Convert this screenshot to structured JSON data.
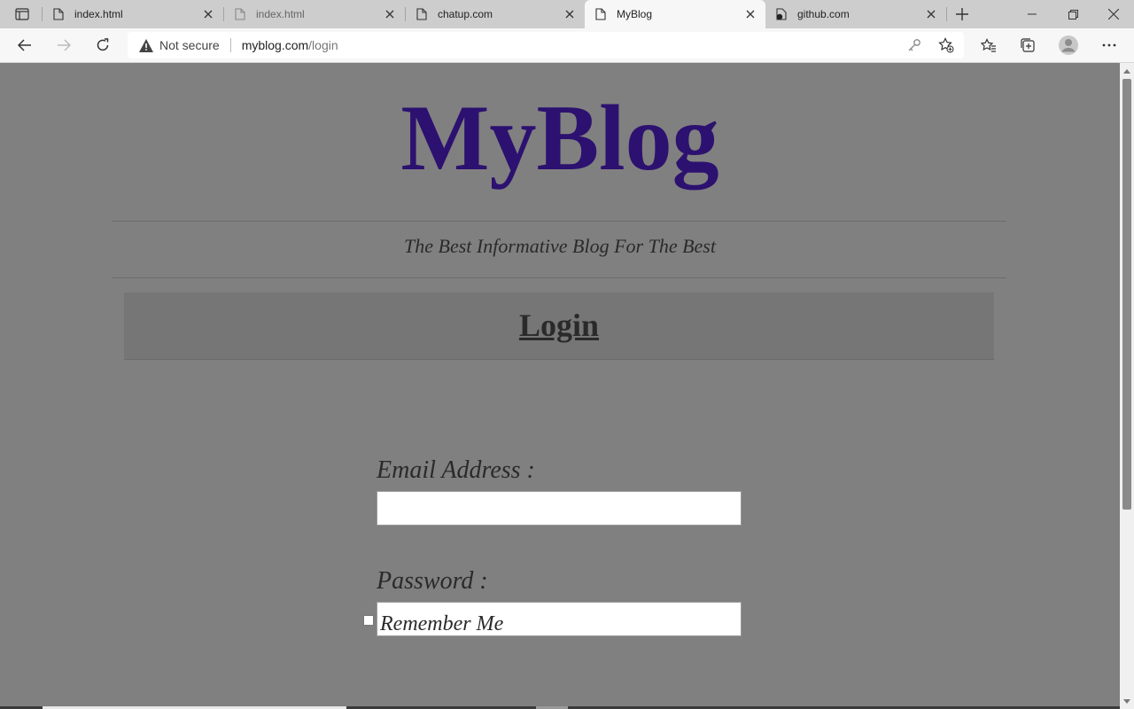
{
  "browser": {
    "tabs": [
      {
        "title": "index.html",
        "favicon": "page-icon",
        "active": false
      },
      {
        "title": "index.html",
        "favicon": "page-icon",
        "active": false
      },
      {
        "title": "chatup.com",
        "favicon": "page-icon",
        "active": false
      },
      {
        "title": "MyBlog",
        "favicon": "page-icon",
        "active": true
      },
      {
        "title": "github.com",
        "favicon": "github-icon",
        "active": false
      }
    ],
    "address": {
      "security_label": "Not secure",
      "url_host": "myblog.com",
      "url_path": "/login"
    }
  },
  "page": {
    "site_title": "MyBlog",
    "tagline": "The Best Informative Blog For The Best",
    "heading": "Login",
    "email_label": "Email Address :",
    "email_value": "",
    "password_label": "Password :",
    "password_value": "",
    "remember_label": "Remember Me",
    "remember_checked": false
  },
  "colors": {
    "title": "#2c1170",
    "page_bg": "#808080",
    "text": "#2a2a2a"
  }
}
